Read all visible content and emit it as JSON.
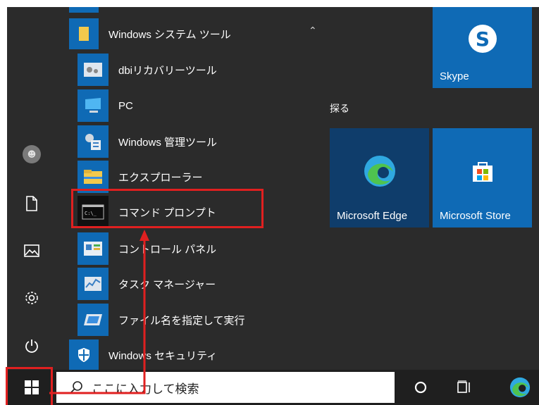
{
  "start_menu": {
    "group": {
      "label": "Windows システム ツール",
      "expanded_icon": "chevron-up-icon"
    },
    "apps": [
      {
        "label": "dbiリカバリーツール",
        "icon": "recovery-tool-icon"
      },
      {
        "label": "PC",
        "icon": "pc-icon"
      },
      {
        "label": "Windows 管理ツール",
        "icon": "admin-tools-icon"
      },
      {
        "label": "エクスプローラー",
        "icon": "folder-icon"
      },
      {
        "label": "コマンド プロンプト",
        "icon": "command-prompt-icon"
      },
      {
        "label": "コントロール パネル",
        "icon": "control-panel-icon"
      },
      {
        "label": "タスク マネージャー",
        "icon": "task-manager-icon"
      },
      {
        "label": "ファイル名を指定して実行",
        "icon": "run-icon"
      }
    ],
    "next_group": {
      "label": "Windows セキュリティ",
      "icon": "shield-icon"
    },
    "tiles_section": "探る",
    "tiles": {
      "skype": "Skype",
      "edge": "Microsoft Edge",
      "store": "Microsoft Store"
    }
  },
  "taskbar": {
    "search_placeholder": "ここに入力して検索"
  },
  "colors": {
    "tile_blue": "#0f6ab5",
    "edge_tile": "#0f3d6b",
    "annotation_red": "#e02020"
  }
}
